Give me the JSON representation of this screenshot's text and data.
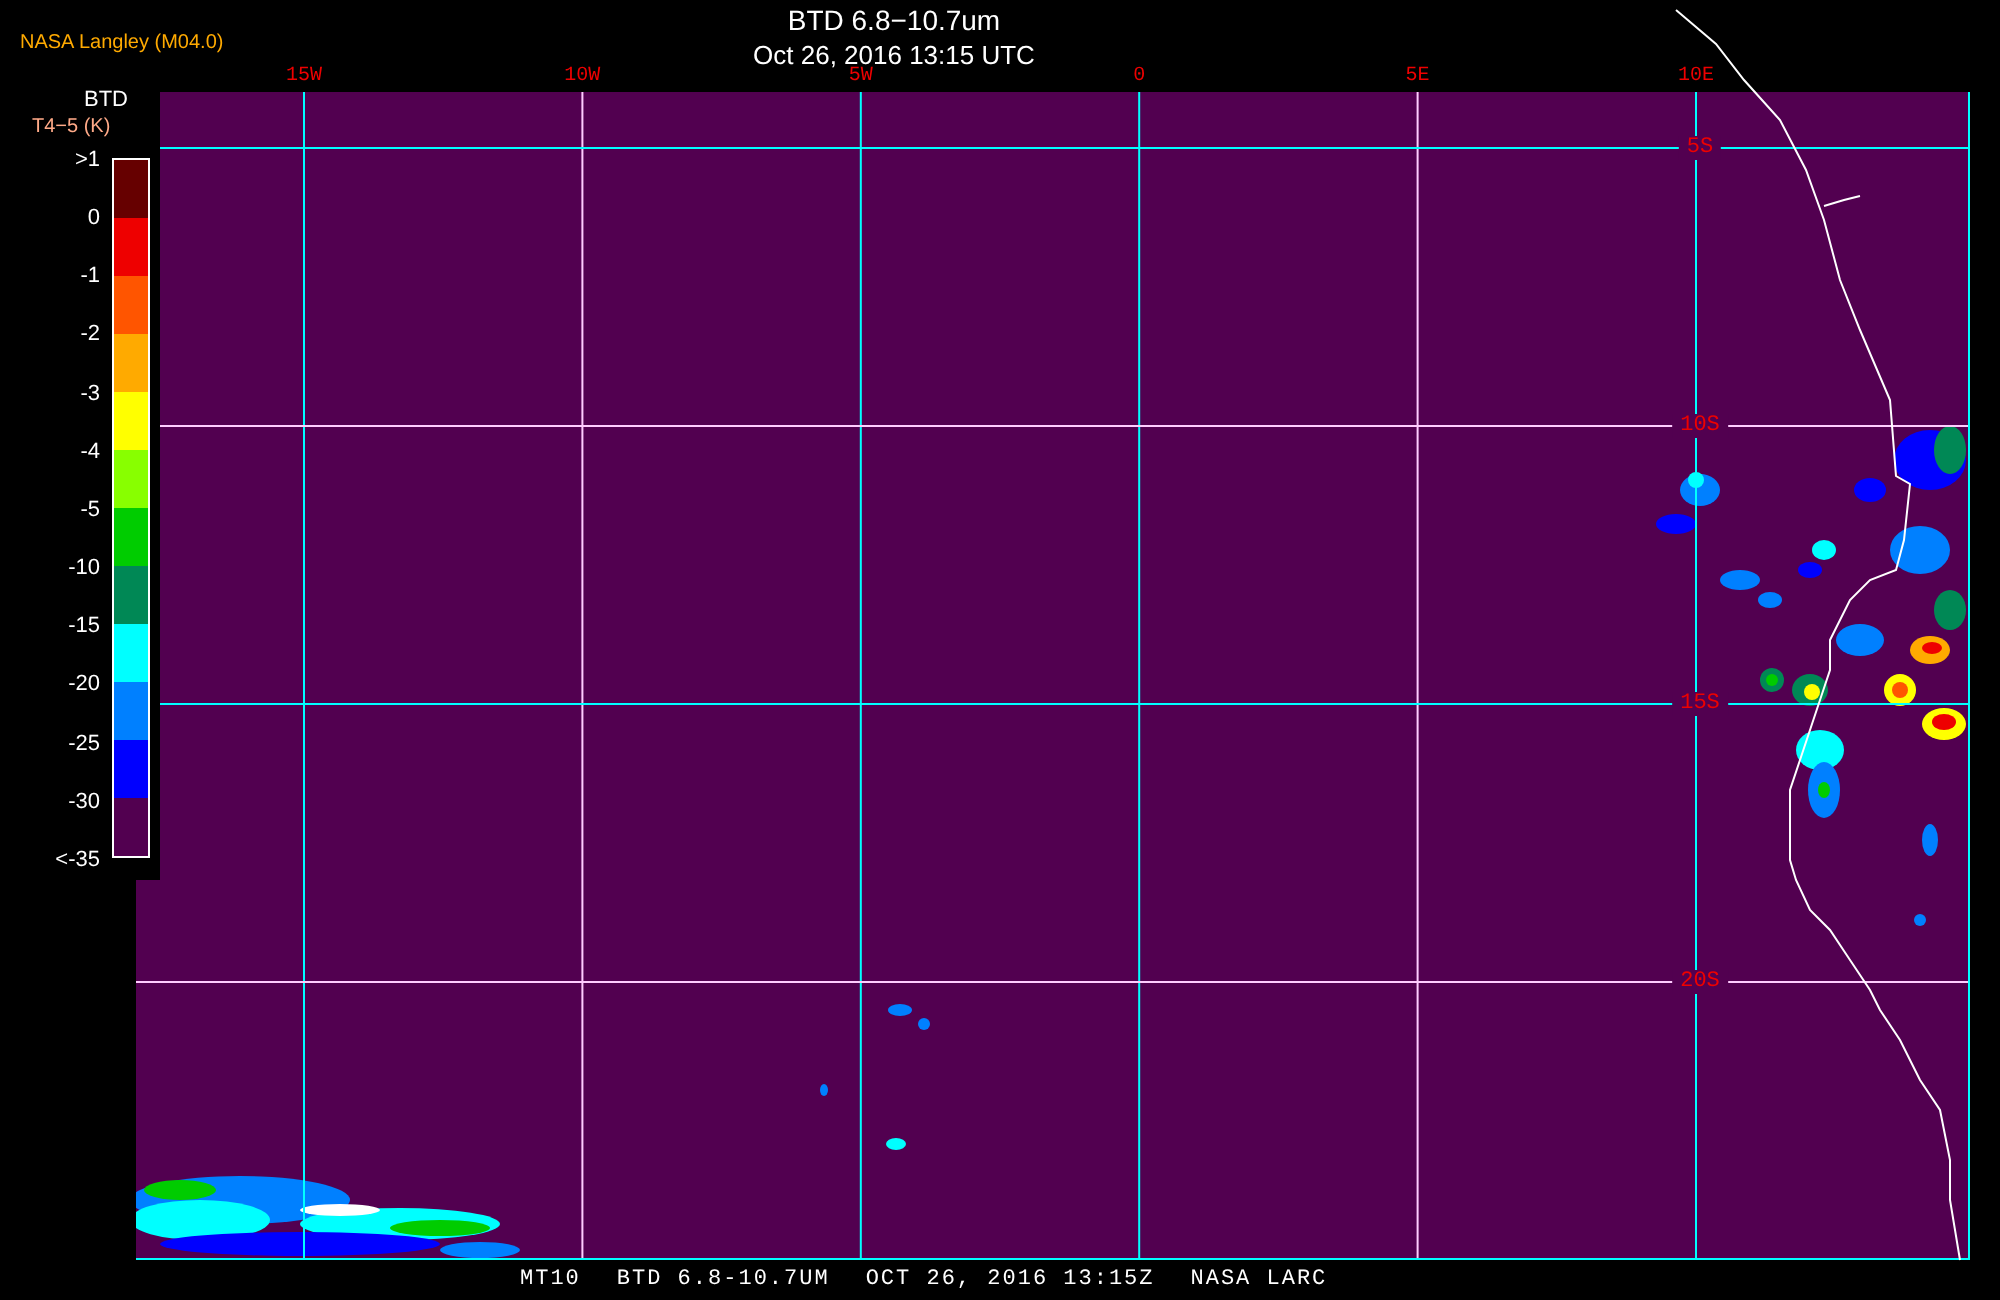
{
  "source_label": "NASA Langley (M04.0)",
  "title": "BTD 6.8−10.7um",
  "subtitle": "Oct 26, 2016 13:15 UTC",
  "legend": {
    "title": "BTD",
    "unit": "T4−5 (K)",
    "labels": [
      ">1",
      "0",
      "-1",
      "-2",
      "-3",
      "-4",
      "-5",
      "-10",
      "-15",
      "-20",
      "-25",
      "-30",
      "<-35"
    ],
    "swatches": [
      {
        "color": "#660000"
      },
      {
        "color": "#ee0000"
      },
      {
        "color": "#ff5500"
      },
      {
        "color": "#ffaa00"
      },
      {
        "color": "#ffff00"
      },
      {
        "color": "#88ff00"
      },
      {
        "color": "#00cc00"
      },
      {
        "color": "#008855"
      },
      {
        "color": "#00ffff"
      },
      {
        "color": "#0080ff"
      },
      {
        "color": "#0000ff"
      },
      {
        "color": "#520050"
      }
    ]
  },
  "longitudes": [
    {
      "label": "15W",
      "color": "#00ffff"
    },
    {
      "label": "10W",
      "color": "#ffccff"
    },
    {
      "label": "5W",
      "color": "#00ffff"
    },
    {
      "label": "0",
      "color": "#00ffff"
    },
    {
      "label": "5E",
      "color": "#ffccff"
    },
    {
      "label": "10E",
      "color": "#00ffff"
    }
  ],
  "latitudes": [
    {
      "label": "5S",
      "color": "#00ffff"
    },
    {
      "label": "10S",
      "color": "#ffccff"
    },
    {
      "label": "15S",
      "color": "#00ffff"
    },
    {
      "label": "20S",
      "color": "#ffccff"
    }
  ],
  "footer": [
    "MT10",
    "BTD 6.8-10.7UM",
    "OCT 26, 2016 13:15Z",
    "NASA LARC"
  ]
}
